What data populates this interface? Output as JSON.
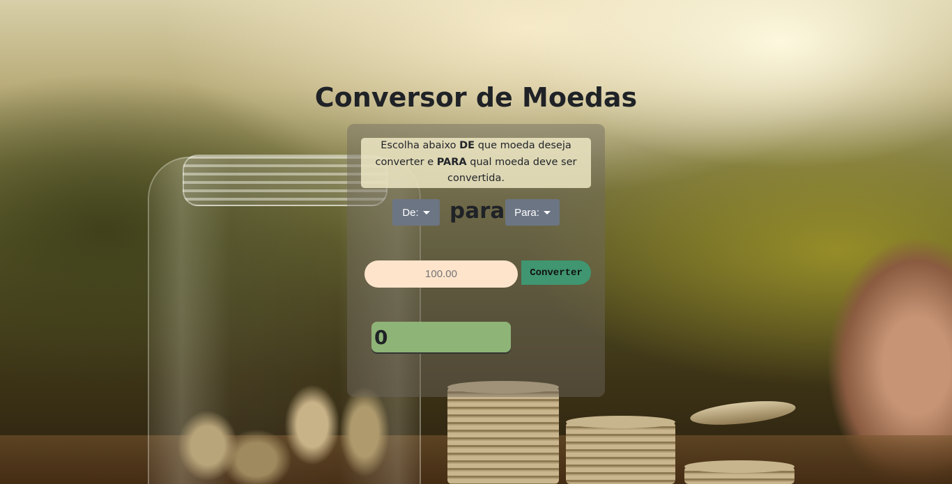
{
  "page": {
    "title": "Conversor de Moedas"
  },
  "instructions": {
    "part1": "Escolha abaixo ",
    "de": "DE",
    "part2": " que moeda deseja converter e ",
    "para": "PARA",
    "part3": " qual moeda deve ser convertida."
  },
  "selectors": {
    "from_label": "De:",
    "separator": "para",
    "to_label": "Para:"
  },
  "amount": {
    "placeholder": "100.00"
  },
  "convert_button": {
    "label": "Converter"
  },
  "result": {
    "value": "0"
  },
  "colors": {
    "dropdown": "#6c7584",
    "amount_field": "#fde4cb",
    "convert_button": "#3f9670",
    "result_box": "#8fb477"
  }
}
